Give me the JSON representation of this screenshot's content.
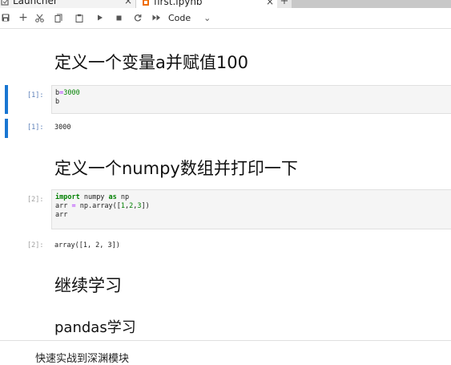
{
  "tabs": [
    {
      "label": "Launcher",
      "icon": "launcher-icon",
      "close": "×"
    },
    {
      "label": "first.ipynb",
      "icon": "notebook-icon",
      "close": "×"
    }
  ],
  "new_tab_symbol": "+",
  "toolbar": {
    "buttons": [
      "save-icon",
      "add-cell-icon",
      "cut-icon",
      "copy-icon",
      "paste-icon",
      "run-icon",
      "stop-icon",
      "restart-icon",
      "fast-forward-icon"
    ],
    "cell_type": "Code",
    "cell_type_chevron": "⌄"
  },
  "cells": {
    "md1": "定义一个变量a并赋值100",
    "c1": {
      "in_prompt": "[1]:",
      "line1_var": "b",
      "line1_op": "=",
      "line1_num": "3000",
      "line2": "b",
      "out_prompt": "[1]:",
      "output": "3000"
    },
    "md2": "定义一个numpy数组并打印一下",
    "c2": {
      "in_prompt": "[2]:",
      "line1_kw1": "import",
      "line1_mid": " numpy ",
      "line1_kw2": "as",
      "line1_end": " np",
      "line2_a": "arr ",
      "line2_op": "=",
      "line2_b": " np.array([",
      "line2_n1": "1",
      "line2_c1": ",",
      "line2_n2": "2",
      "line2_c2": ",",
      "line2_n3": "3",
      "line2_end": "])",
      "line3": "arr",
      "out_prompt": "[2]:",
      "output": "array([1, 2, 3])"
    },
    "md3": "继续学习",
    "md4": "pandas学习"
  },
  "bottom_text": "快速实战到深渊模块"
}
